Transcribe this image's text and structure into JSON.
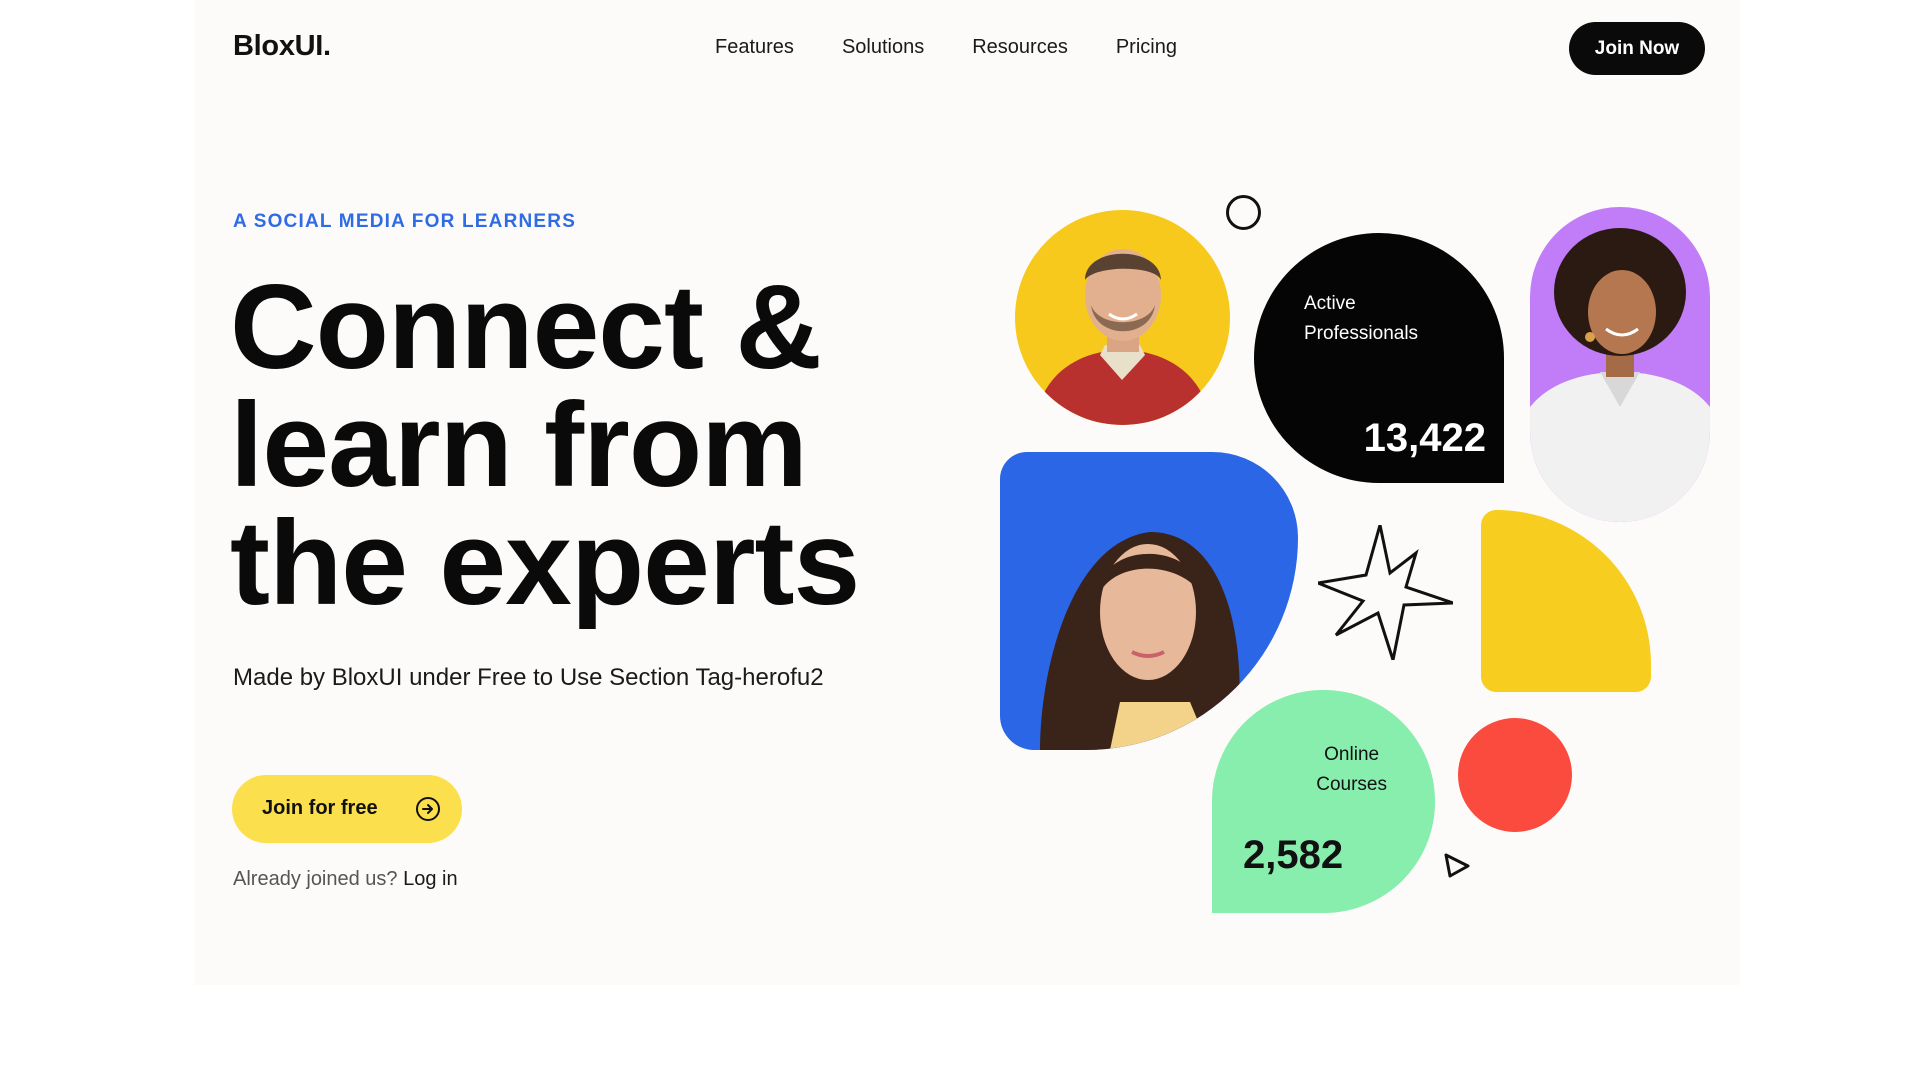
{
  "brand": {
    "logo_text": "BloxUI."
  },
  "nav": {
    "items": [
      "Features",
      "Solutions",
      "Resources",
      "Pricing"
    ]
  },
  "header": {
    "cta_label": "Join Now"
  },
  "hero": {
    "eyebrow": "A SOCIAL MEDIA FOR LEARNERS",
    "headline_lines": [
      "Connect &",
      "learn from",
      "the experts"
    ],
    "subtitle": "Made by BloxUI under Free to Use Section Tag-herofu2",
    "cta_label": "Join for free",
    "cta_icon": "arrow-right-circle-icon",
    "login_prompt": "Already joined us?",
    "login_link": "Log in"
  },
  "stats": {
    "active": {
      "label_lines": [
        "Active",
        "Professionals"
      ],
      "value": "13,422"
    },
    "courses": {
      "label_lines": [
        "Online",
        "Courses"
      ],
      "value": "2,582"
    }
  },
  "colors": {
    "accent_blue": "#2f6be3",
    "cta_yellow": "#fbdf4c",
    "shape_yellow": "#f7ce1f",
    "shape_purple": "#c17cf7",
    "shape_blue": "#2a66e6",
    "shape_green": "#87eeae",
    "shape_red": "#fb4b3f",
    "dark": "#0a0a0a"
  }
}
